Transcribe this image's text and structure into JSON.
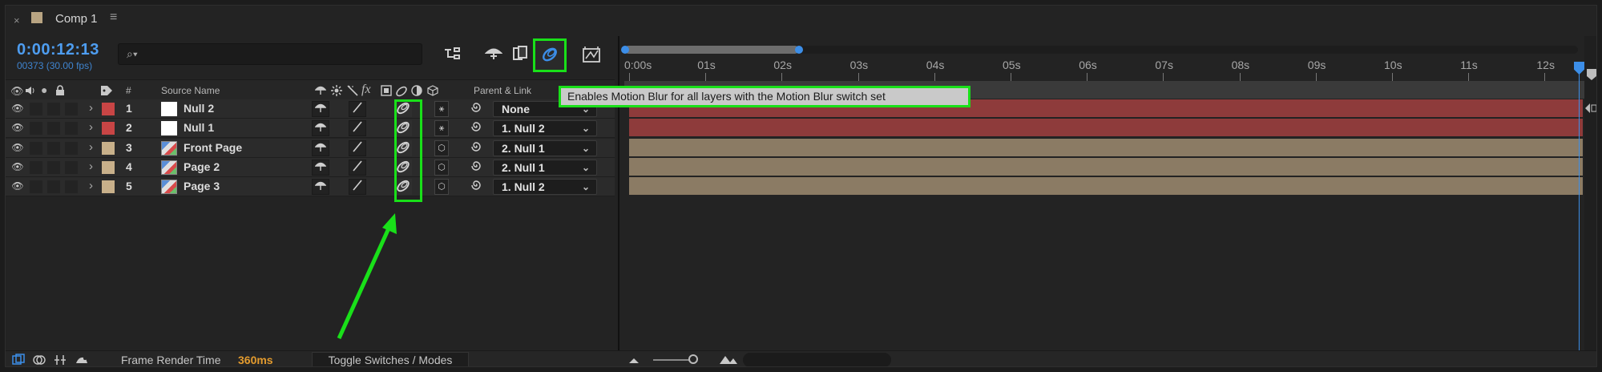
{
  "tab": {
    "close": "×",
    "title": "Comp 1",
    "menu": "≡"
  },
  "timecode": "0:00:12:13",
  "frame_info": "00373 (30.00 fps)",
  "search": {
    "icon": "⌕▾",
    "placeholder": ""
  },
  "columns": {
    "label": "#",
    "source_name": "Source Name",
    "parent_link": "Parent & Link"
  },
  "layers": [
    {
      "num": "1",
      "name": "Null 2",
      "label_color": "#c84545",
      "thumb": "solid",
      "parent": "None",
      "bar": "red"
    },
    {
      "num": "2",
      "name": "Null 1",
      "label_color": "#c84545",
      "thumb": "solid",
      "parent": "1. Null 2",
      "bar": "red"
    },
    {
      "num": "3",
      "name": "Front Page",
      "label_color": "#c8b08a",
      "thumb": "comp",
      "parent": "2. Null 1",
      "bar": "tan"
    },
    {
      "num": "4",
      "name": "Page 2",
      "label_color": "#c8b08a",
      "thumb": "comp",
      "parent": "2. Null 1",
      "bar": "tan"
    },
    {
      "num": "5",
      "name": "Page 3",
      "label_color": "#c8b08a",
      "thumb": "comp",
      "parent": "1. Null 2",
      "bar": "tan"
    }
  ],
  "ruler": [
    "0:00s",
    "01s",
    "02s",
    "03s",
    "04s",
    "05s",
    "06s",
    "07s",
    "08s",
    "09s",
    "10s",
    "11s",
    "12s"
  ],
  "tooltip": "Enables Motion Blur for all layers with the Motion Blur switch set",
  "bottom": {
    "render_label": "Frame Render Time",
    "render_value": "360ms",
    "toggle": "Toggle Switches / Modes"
  },
  "colors": {
    "accent": "#3c8ee8",
    "highlight": "#19e019",
    "render_time": "#e39b2e"
  }
}
